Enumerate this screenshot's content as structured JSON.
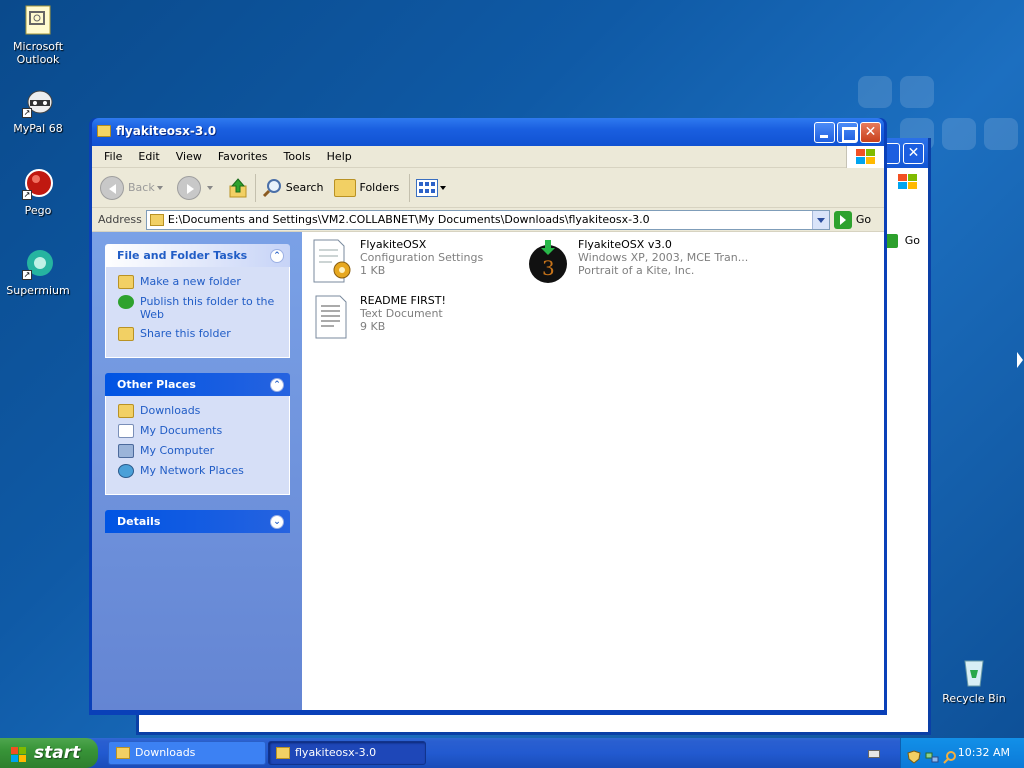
{
  "desktop": {
    "icons": [
      {
        "label": "Microsoft Outlook"
      },
      {
        "label": "MyPal 68"
      },
      {
        "label": "Pego"
      },
      {
        "label": "Supermium"
      },
      {
        "label": "Recycle Bin"
      }
    ]
  },
  "back_window": {
    "go_label": "Go"
  },
  "window": {
    "title": "flyakiteosx-3.0",
    "menu": [
      "File",
      "Edit",
      "View",
      "Favorites",
      "Tools",
      "Help"
    ],
    "toolbar": {
      "back": "Back",
      "search": "Search",
      "folders": "Folders"
    },
    "address": {
      "label": "Address",
      "path": "E:\\Documents and Settings\\VM2.COLLABNET\\My Documents\\Downloads\\flyakiteosx-3.0",
      "go": "Go"
    },
    "tasks_panel": {
      "title": "File and Folder Tasks",
      "items": [
        "Make a new folder",
        "Publish this folder to the Web",
        "Share this folder"
      ]
    },
    "places_panel": {
      "title": "Other Places",
      "items": [
        "Downloads",
        "My Documents",
        "My Computer",
        "My Network Places"
      ]
    },
    "details_panel": {
      "title": "Details"
    },
    "files": [
      {
        "name": "FlyakiteOSX",
        "line2": "Configuration Settings",
        "line3": "1 KB",
        "icon": "config-settings-icon"
      },
      {
        "name": "FlyakiteOSX v3.0",
        "line2": "Windows XP, 2003, MCE Tran...",
        "line3": "Portrait of a Kite, Inc.",
        "icon": "installer-icon"
      },
      {
        "name": "README FIRST!",
        "line2": "Text Document",
        "line3": "9 KB",
        "icon": "text-document-icon"
      }
    ]
  },
  "taskbar": {
    "start": "start",
    "buttons": [
      {
        "label": "Downloads",
        "active": false
      },
      {
        "label": "flyakiteosx-3.0",
        "active": true
      }
    ],
    "clock": "10:32 AM"
  },
  "colors": {
    "desktop_blue": "#0f5aa6",
    "titlebar_blue": "#1a5fe0",
    "taskpane_blue": "#6485d3",
    "link_blue": "#215dc6",
    "start_green": "#389438"
  }
}
